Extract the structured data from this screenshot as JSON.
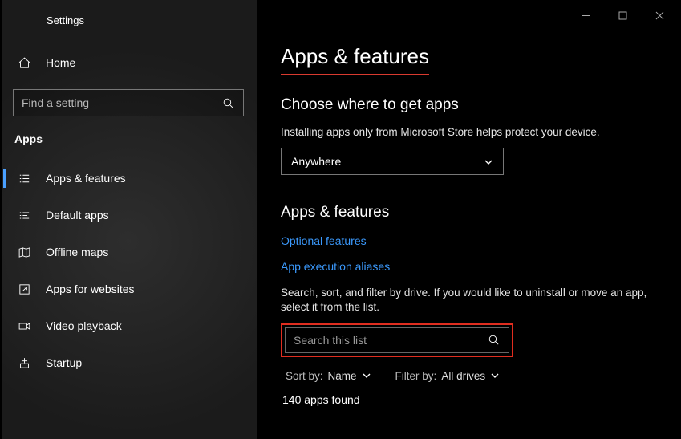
{
  "window": {
    "title": "Settings"
  },
  "sidebar": {
    "home": "Home",
    "search_placeholder": "Find a setting",
    "section": "Apps",
    "items": [
      {
        "label": "Apps & features"
      },
      {
        "label": "Default apps"
      },
      {
        "label": "Offline maps"
      },
      {
        "label": "Apps for websites"
      },
      {
        "label": "Video playback"
      },
      {
        "label": "Startup"
      }
    ]
  },
  "main": {
    "title": "Apps & features",
    "choose_heading": "Choose where to get apps",
    "choose_desc": "Installing apps only from Microsoft Store helps protect your device.",
    "source_selected": "Anywhere",
    "section_heading": "Apps & features",
    "link_optional": "Optional features",
    "link_aliases": "App execution aliases",
    "filter_desc": "Search, sort, and filter by drive. If you would like to uninstall or move an app, select it from the list.",
    "search_placeholder": "Search this list",
    "sort_label": "Sort by:",
    "sort_value": "Name",
    "filter_label": "Filter by:",
    "filter_value": "All drives",
    "count_text": "140 apps found"
  }
}
